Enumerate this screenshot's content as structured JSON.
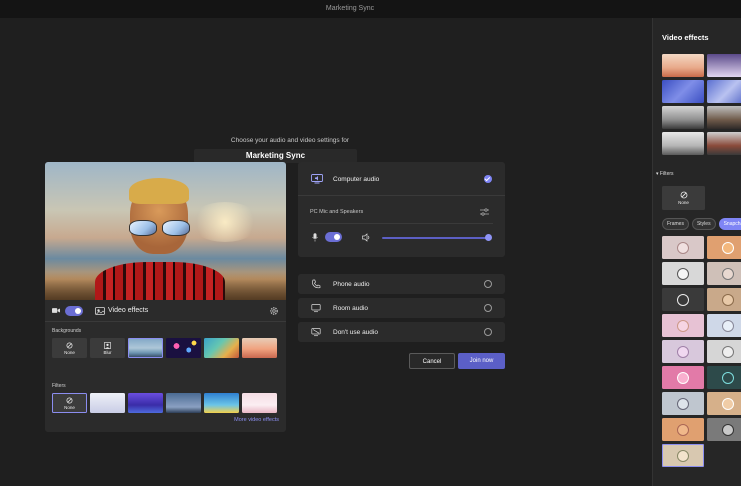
{
  "window": {
    "title": "Marketing Sync"
  },
  "prejoin": {
    "prompt": "Choose your audio and video settings for",
    "meeting_name": "Marketing Sync"
  },
  "video_controls": {
    "camera_on": true,
    "video_effects_label": "Video effects"
  },
  "backgrounds": {
    "label": "Backgrounds",
    "items": [
      {
        "label": "None",
        "icon": "none-icon"
      },
      {
        "label": "Blur",
        "icon": "blur-icon"
      },
      {
        "label": ""
      },
      {
        "label": ""
      },
      {
        "label": ""
      },
      {
        "label": ""
      }
    ]
  },
  "filters": {
    "label": "Filters",
    "items": [
      {
        "label": "None"
      },
      {
        "label": ""
      },
      {
        "label": ""
      },
      {
        "label": ""
      },
      {
        "label": ""
      },
      {
        "label": ""
      }
    ]
  },
  "more_link": "More video effects",
  "audio": {
    "computer_audio": "Computer audio",
    "device": "PC Mic and Speakers",
    "mic_on": true,
    "volume_level": 1.0,
    "options": [
      {
        "label": "Phone audio",
        "icon": "phone-icon"
      },
      {
        "label": "Room audio",
        "icon": "room-icon"
      },
      {
        "label": "Don't use audio",
        "icon": "no-audio-icon"
      }
    ]
  },
  "buttons": {
    "cancel": "Cancel",
    "join": "Join now"
  },
  "side_panel": {
    "title": "Video effects",
    "filters_label": "Filters",
    "none_label": "None",
    "tabs": [
      "Frames",
      "Styles",
      "Snapchat"
    ],
    "active_tab": "Snapchat"
  }
}
